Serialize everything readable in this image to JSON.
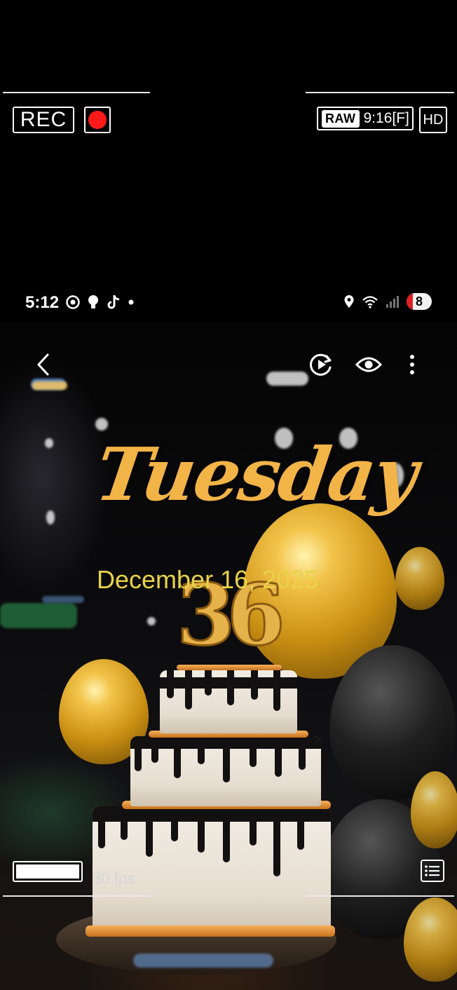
{
  "recorder": {
    "rec_label": "REC",
    "raw_label": "RAW",
    "aspect_label": "9:16[F]",
    "quality_label": "HD",
    "fps_label": "30 fps",
    "level_fraction": 1.0,
    "record_color": "#ff1a1a"
  },
  "status_bar": {
    "time": "5:12",
    "left_icons": [
      "chrome-icon",
      "bulb-icon",
      "tiktok-icon",
      "dot-icon"
    ],
    "right_icons": [
      "location-icon",
      "wifi-icon",
      "signal-icon"
    ],
    "battery_level": "8",
    "battery_low_color": "#e01e1e"
  },
  "viewer_toolbar": {
    "back_icon": "chevron-left-icon",
    "motion_icon": "play-refresh-icon",
    "preview_icon": "eye-icon",
    "more_icon": "more-vertical-icon"
  },
  "wallpaper": {
    "day": "Tuesday",
    "date": "December 16, 2025",
    "candle_number": "36",
    "day_color": "#f2b347",
    "date_color": "#e8d348"
  }
}
